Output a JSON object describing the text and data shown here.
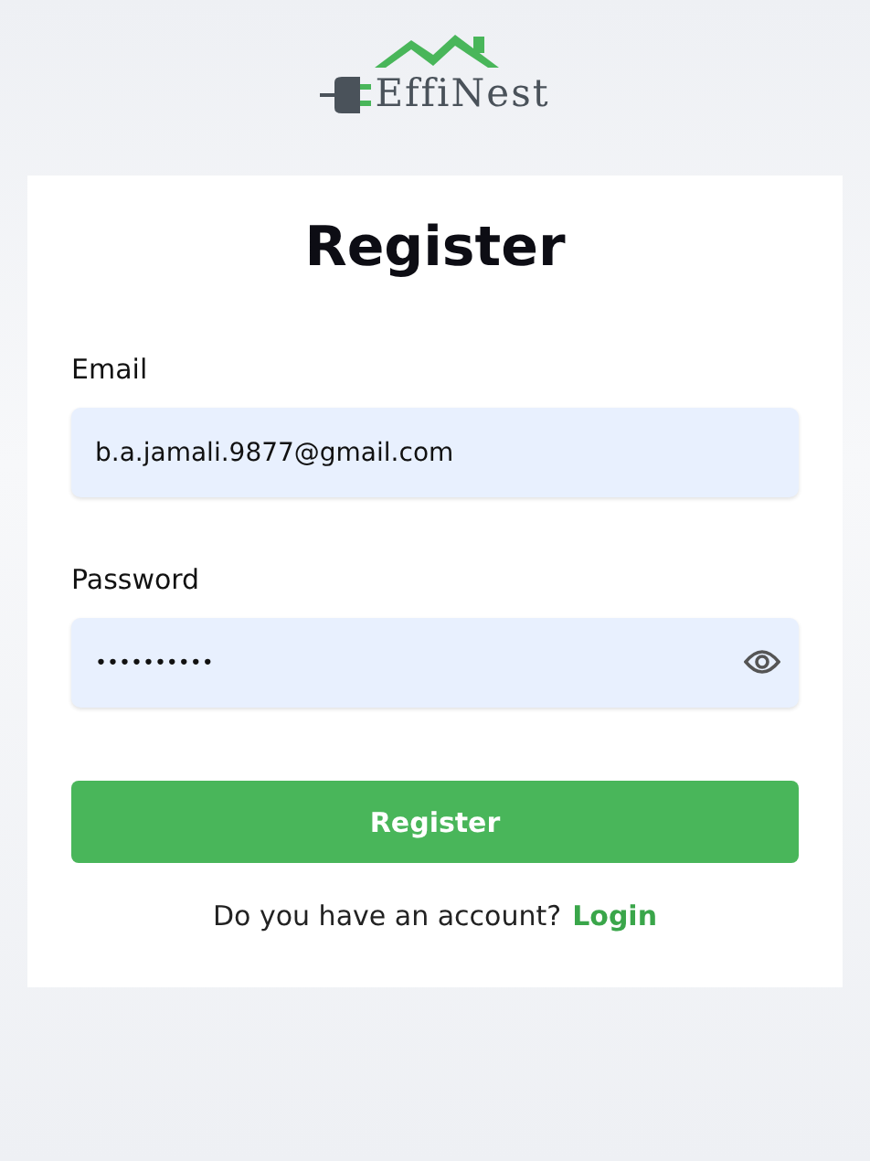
{
  "logo": {
    "text": "EffiNest"
  },
  "title": "Register",
  "fields": [
    {
      "label": "Email",
      "value": "b.a.jamali.9877@gmail.com",
      "kind": "text"
    },
    {
      "label": "Password",
      "value": "••••••••••",
      "kind": "password"
    }
  ],
  "submit": "Register",
  "footer": {
    "text": "Do you have an account?",
    "link": "Login"
  }
}
